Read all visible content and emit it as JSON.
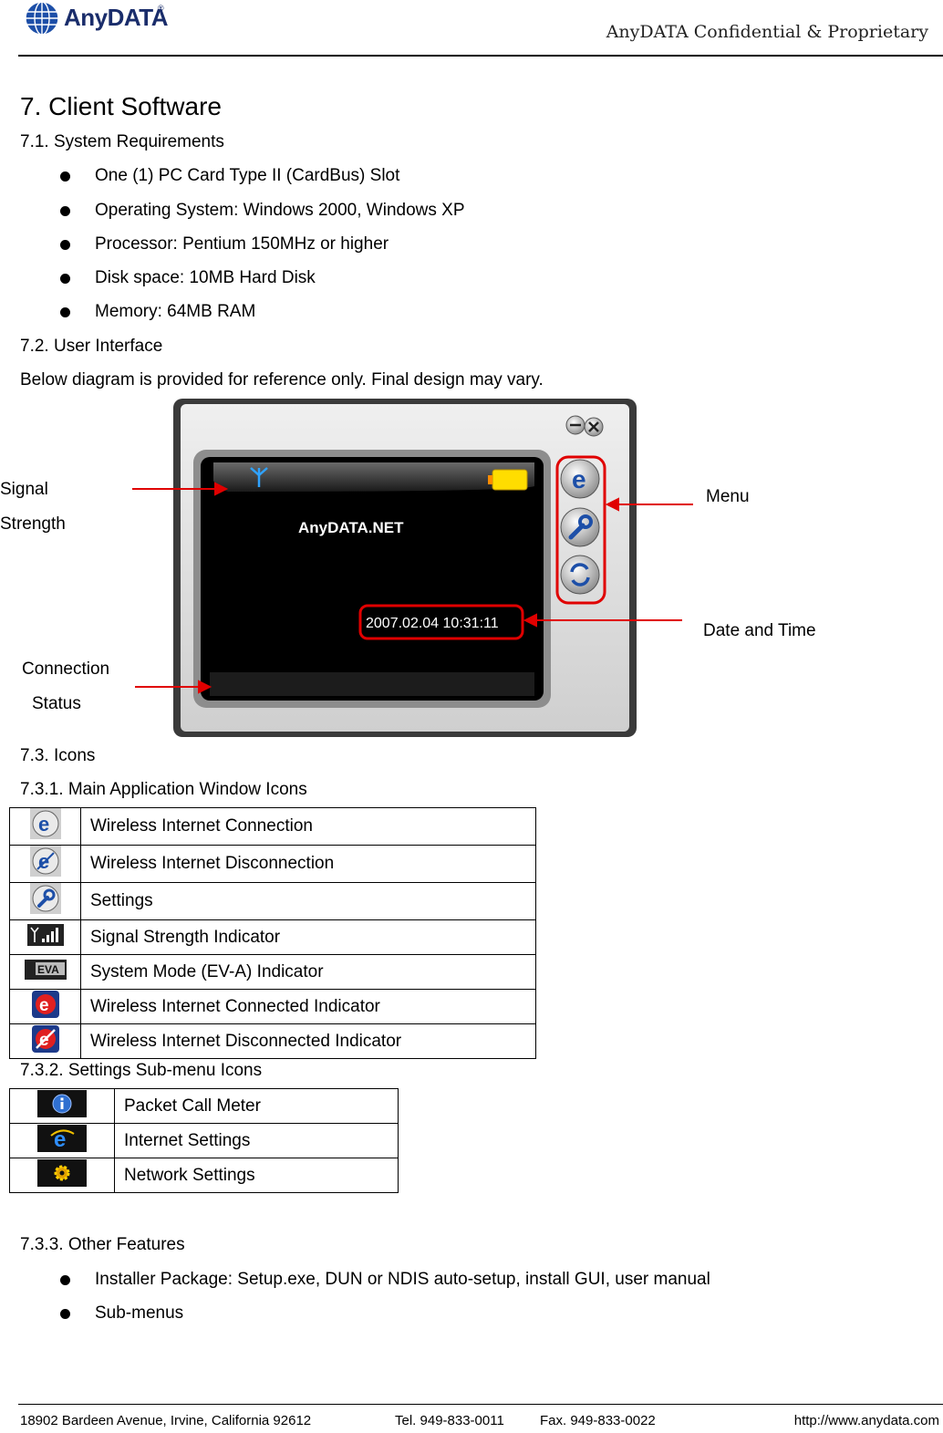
{
  "header": {
    "logo_text": "AnyDATA",
    "logo_reg": "®",
    "confidential": "AnyDATA Confidential & Proprietary"
  },
  "section7": {
    "title": "7.  Client Software",
    "s71": "7.1.    System Requirements",
    "requirements": [
      "One (1) PC Card Type II (CardBus) Slot",
      "Operating System: Windows 2000, Windows XP",
      "Processor: Pentium 150MHz or higher",
      "Disk space: 10MB Hard Disk",
      "Memory: 64MB RAM"
    ],
    "s72": "7.2.    User Interface",
    "diagram_note": "Below diagram is provided for reference only.    Final design may vary."
  },
  "diagram": {
    "screen_brand": "AnyDATA.NET",
    "datetime": "2007.02.04 10:31:11",
    "labels": {
      "signal_1": "Signal",
      "signal_2": "Strength",
      "menu": "Menu",
      "date_time": "Date and Time",
      "connection_1": "Connection",
      "connection_2": "Status"
    }
  },
  "icons_section": {
    "s73": "7.3.    Icons",
    "s731": "7.3.1.    Main Application Window Icons",
    "main_icons": [
      {
        "icon": "e-connect-icon",
        "label": "Wireless Internet Connection"
      },
      {
        "icon": "e-disconnect-icon",
        "label": "Wireless Internet Disconnection"
      },
      {
        "icon": "wrench-icon",
        "label": "Settings"
      },
      {
        "icon": "signal-bars-icon",
        "label": "Signal Strength Indicator"
      },
      {
        "icon": "eva-mode-icon",
        "label": "System Mode (EV-A) Indicator",
        "icon_text": "EVA"
      },
      {
        "icon": "e-connected-icon",
        "label": "Wireless Internet Connected Indicator"
      },
      {
        "icon": "e-disconnected-icon",
        "label": "Wireless Internet Disconnected Indicator"
      }
    ],
    "s732": "7.3.2.    Settings Sub-menu Icons",
    "submenu_icons": [
      {
        "icon": "info-icon",
        "label": "Packet Call Meter"
      },
      {
        "icon": "internet-e-icon",
        "label": "Internet Settings"
      },
      {
        "icon": "network-gear-icon",
        "label": "Network Settings"
      }
    ],
    "s733": "7.3.3.    Other Features",
    "features": [
      "Installer Package: Setup.exe, DUN or NDIS auto-setup, install GUI, user manual",
      "Sub-menus"
    ]
  },
  "footer": {
    "address": "18902 Bardeen Avenue, Irvine, California 92612",
    "tel": "Tel. 949-833-0011",
    "fax": "Fax. 949-833-0022",
    "url": "http://www.anydata.com"
  },
  "colors": {
    "annotation_red": "#e00000",
    "logo_blue": "#1a2d6b",
    "screen_bg": "#000000",
    "device_gray": "#d6d6d6"
  }
}
